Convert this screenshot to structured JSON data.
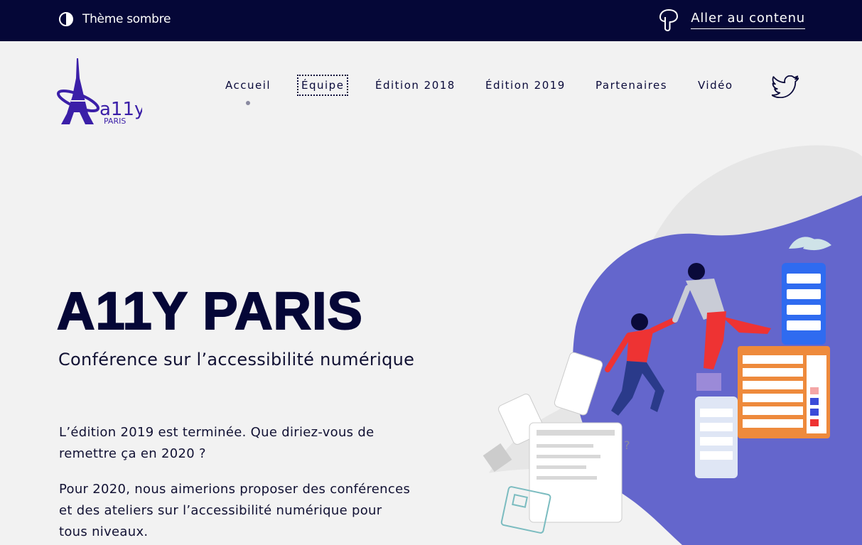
{
  "topbar": {
    "theme_toggle_label": "Thème sombre",
    "skip_link_label": "Aller au contenu",
    "background": "#050737"
  },
  "logo": {
    "text": "a11y",
    "subtext": "PARIS",
    "color": "#3b1fa8"
  },
  "nav": {
    "items": [
      {
        "label": "Accueil",
        "current": true
      },
      {
        "label": "Équipe",
        "focused": true
      },
      {
        "label": "Édition 2018"
      },
      {
        "label": "Édition 2019"
      },
      {
        "label": "Partenaires"
      },
      {
        "label": "Vidéo"
      }
    ],
    "social_icon": "twitter-icon"
  },
  "hero": {
    "title": "A11Y PARIS",
    "subtitle": "Conférence sur l’accessibilité numérique",
    "paragraph_1": "L’édition 2019 est terminée. Que diriez-vous de remettre ça en 2020 ?",
    "paragraph_2": "Pour 2020, nous aimerions proposer des conférences et des ateliers sur l’accessibilité numérique pour tous niveaux."
  },
  "colors": {
    "page_bg": "#f2f2f2",
    "accent_blob": "#6466cc",
    "text": "#050737"
  }
}
